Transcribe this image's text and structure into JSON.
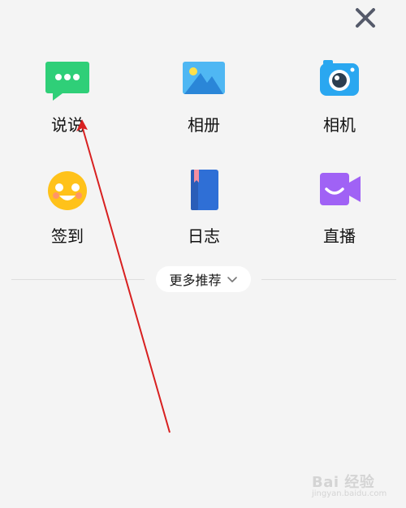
{
  "header": {
    "close_icon": "close-icon"
  },
  "grid": {
    "items": [
      {
        "label": "说说",
        "icon": "chat-bubble-icon",
        "color": "#2fcf78"
      },
      {
        "label": "相册",
        "icon": "photo-album-icon",
        "color": "#4fb7f3"
      },
      {
        "label": "相机",
        "icon": "camera-icon",
        "color": "#2aa7f0"
      },
      {
        "label": "签到",
        "icon": "smiley-face-icon",
        "color": "#ffc21a"
      },
      {
        "label": "日志",
        "icon": "journal-book-icon",
        "color": "#2f6fd6"
      },
      {
        "label": "直播",
        "icon": "video-camera-icon",
        "color": "#a062f5"
      }
    ]
  },
  "more": {
    "label": "更多推荐",
    "icon": "chevron-down-icon"
  },
  "watermark": {
    "text": "Bai 经验",
    "subtext": "jingyan.baidu.com"
  },
  "annotation": {
    "color": "#d82020"
  }
}
